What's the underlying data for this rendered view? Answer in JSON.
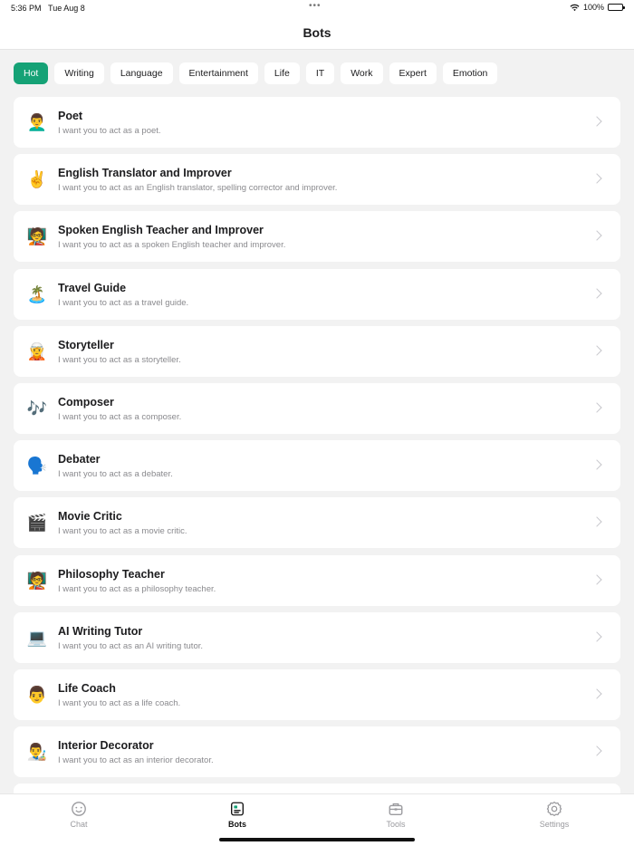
{
  "status_bar": {
    "time": "5:36 PM",
    "date": "Tue Aug 8",
    "dots": "•••",
    "battery_text": "100%"
  },
  "header": {
    "title": "Bots"
  },
  "categories": [
    {
      "label": "Hot",
      "selected": true
    },
    {
      "label": "Writing",
      "selected": false
    },
    {
      "label": "Language",
      "selected": false
    },
    {
      "label": "Entertainment",
      "selected": false
    },
    {
      "label": "Life",
      "selected": false
    },
    {
      "label": "IT",
      "selected": false
    },
    {
      "label": "Work",
      "selected": false
    },
    {
      "label": "Expert",
      "selected": false
    },
    {
      "label": "Emotion",
      "selected": false
    }
  ],
  "bots": [
    {
      "emoji": "👨‍🦱",
      "title": "Poet",
      "desc": "I want you to act as a poet."
    },
    {
      "emoji": "✌️",
      "title": "English Translator and Improver",
      "desc": "I want you to act as an English translator, spelling corrector and improver."
    },
    {
      "emoji": "🧑‍🏫",
      "title": "Spoken English Teacher and Improver",
      "desc": "I want you to act as a spoken English teacher and improver."
    },
    {
      "emoji": "🏝️",
      "title": "Travel Guide",
      "desc": "I want you to act as a travel guide."
    },
    {
      "emoji": "🧝",
      "title": "Storyteller",
      "desc": "I want you to act as a storyteller."
    },
    {
      "emoji": "🎶",
      "title": "Composer",
      "desc": "I want you to act as a composer."
    },
    {
      "emoji": "🗣️",
      "title": "Debater",
      "desc": "I want you to act as a debater."
    },
    {
      "emoji": "🎬",
      "title": "Movie Critic",
      "desc": "I want you to act as a movie critic."
    },
    {
      "emoji": "🧑‍🏫",
      "title": "Philosophy Teacher",
      "desc": "I want you to act as a philosophy teacher."
    },
    {
      "emoji": "💻",
      "title": "AI Writing Tutor",
      "desc": "I want you to act as an AI writing tutor."
    },
    {
      "emoji": "👨",
      "title": "Life Coach",
      "desc": "I want you to act as a life coach."
    },
    {
      "emoji": "👨‍🎨",
      "title": "Interior Decorator",
      "desc": "I want you to act as an interior decorator."
    }
  ],
  "tabs": [
    {
      "label": "Chat",
      "icon": "smiley-icon",
      "active": false
    },
    {
      "label": "Bots",
      "icon": "bots-icon",
      "active": true
    },
    {
      "label": "Tools",
      "icon": "toolbox-icon",
      "active": false
    },
    {
      "label": "Settings",
      "icon": "gear-icon",
      "active": false
    }
  ],
  "colors": {
    "accent": "#15a276",
    "background": "#f2f2f2",
    "card": "#ffffff",
    "secondary_text": "#8a8a8e"
  }
}
